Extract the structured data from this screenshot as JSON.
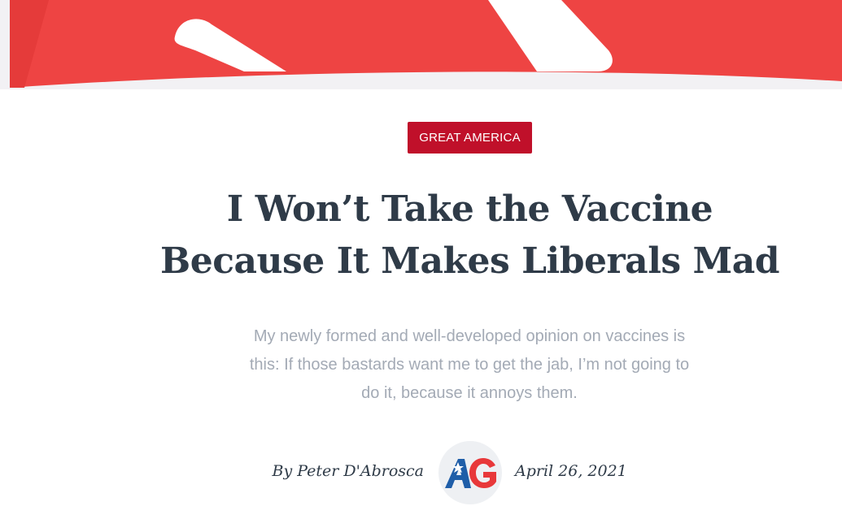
{
  "colors": {
    "banner_red": "#ee4443",
    "badge_red": "#c0102a",
    "title_text": "#2f3b48",
    "excerpt_text": "#a3aab5",
    "logo_blue": "#1f5ea8",
    "logo_red": "#e8383a"
  },
  "article": {
    "category": "GREAT AMERICA",
    "title_lines": [
      "I Won’t Take the Vaccine",
      "Because It Makes Liberals Mad"
    ],
    "excerpt_lines": [
      "My newly formed and well-developed opinion on vaccines is",
      "this: If those bastards want me to get the jab, I’m not going to",
      "do it, because it annoys them."
    ],
    "author": "By Peter D'Abrosca",
    "date": "April 26, 2021"
  },
  "logo": {
    "icon": "american-greatness-logo",
    "letters": "AG"
  }
}
